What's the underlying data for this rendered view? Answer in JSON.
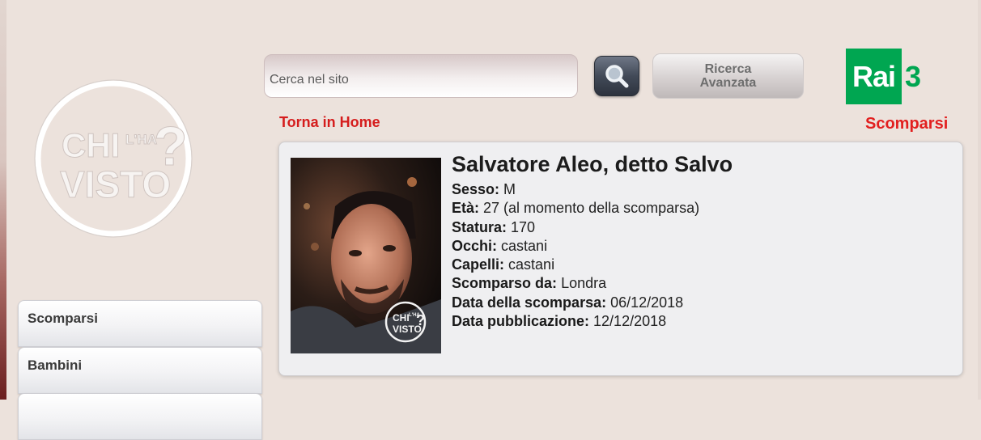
{
  "search": {
    "placeholder": "Cerca nel sito",
    "button_icon": "magnifier-icon",
    "advanced_line1": "Ricerca",
    "advanced_line2": "Avanzata"
  },
  "brand": {
    "logo_text": [
      "CHI",
      "L'HA",
      "VISTO",
      "?"
    ],
    "rai_text": "Rai",
    "rai_number": "3",
    "rai_color": "#00a651"
  },
  "nav": {
    "home_link": "Torna in Home",
    "section_link": "Scomparsi",
    "link_color": "#e21f1f"
  },
  "sidebar": {
    "items": [
      {
        "label": "Scomparsi"
      },
      {
        "label": "Bambini"
      }
    ]
  },
  "person": {
    "name": "Salvatore Aleo, detto Salvo",
    "fields": [
      {
        "label": "Sesso:",
        "value": "M"
      },
      {
        "label": "Età:",
        "value": "27 (al momento della scomparsa)"
      },
      {
        "label": "Statura:",
        "value": "170"
      },
      {
        "label": "Occhi:",
        "value": "castani"
      },
      {
        "label": "Capelli:",
        "value": "castani"
      },
      {
        "label": "Scomparso da:",
        "value": "Londra"
      },
      {
        "label": "Data della scomparsa:",
        "value": "06/12/2018"
      },
      {
        "label": "Data pubblicazione:",
        "value": "12/12/2018"
      }
    ],
    "photo_watermark": [
      "CHI",
      "L'HA",
      "VISTO",
      "?"
    ]
  }
}
